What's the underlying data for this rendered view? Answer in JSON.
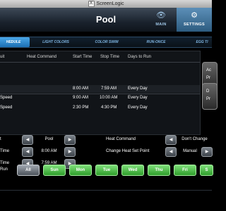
{
  "window": {
    "title": "ScreenLogic",
    "close_glyph": "X"
  },
  "header": {
    "title": "Pool"
  },
  "nav": {
    "main_label": "MAIN",
    "settings_label": "SETTINGS",
    "main_icon": "eye-icon",
    "settings_icon": "gear-icon"
  },
  "tabs": [
    "HEDULE",
    "LIGHT COLORS",
    "COLOR SWIM",
    "RUN-ONCE",
    "EGG TI"
  ],
  "table": {
    "headers": [
      "uit",
      "Heat Command",
      "Start Time",
      "Stop Time",
      "Days to Run"
    ],
    "rows": [
      {
        "circuit": "",
        "heat": "",
        "start": "8:00 AM",
        "stop": "7:59 AM",
        "days": "Every Day"
      },
      {
        "circuit": "Speed",
        "heat": "",
        "start": "9:00 AM",
        "stop": "10:00 AM",
        "days": "Every Day"
      },
      {
        "circuit": "Speed",
        "heat": "",
        "start": "2:30 PM",
        "stop": "4:30 PM",
        "days": "Every Day"
      }
    ]
  },
  "side_buttons": [
    {
      "line1": "Ac",
      "line2": "Pr"
    },
    {
      "line1": "D",
      "line2": "Pr"
    }
  ],
  "controls": {
    "circuit_label": "t",
    "circuit_value": "Pool",
    "start_label": "Time",
    "start_value": "8:00 AM",
    "stop_label": "Time",
    "stop_value": "7:59 AM",
    "heat_command_label": "Heat Command",
    "heat_command_value": "Don't Change",
    "heat_setpoint_label": "Change Heat Set Point",
    "heat_setpoint_value": "Manual"
  },
  "days": {
    "label": "Run",
    "buttons": [
      "All",
      "Sun",
      "Mon",
      "Tue",
      "Wed",
      "Thu",
      "Fri",
      "S"
    ]
  }
}
